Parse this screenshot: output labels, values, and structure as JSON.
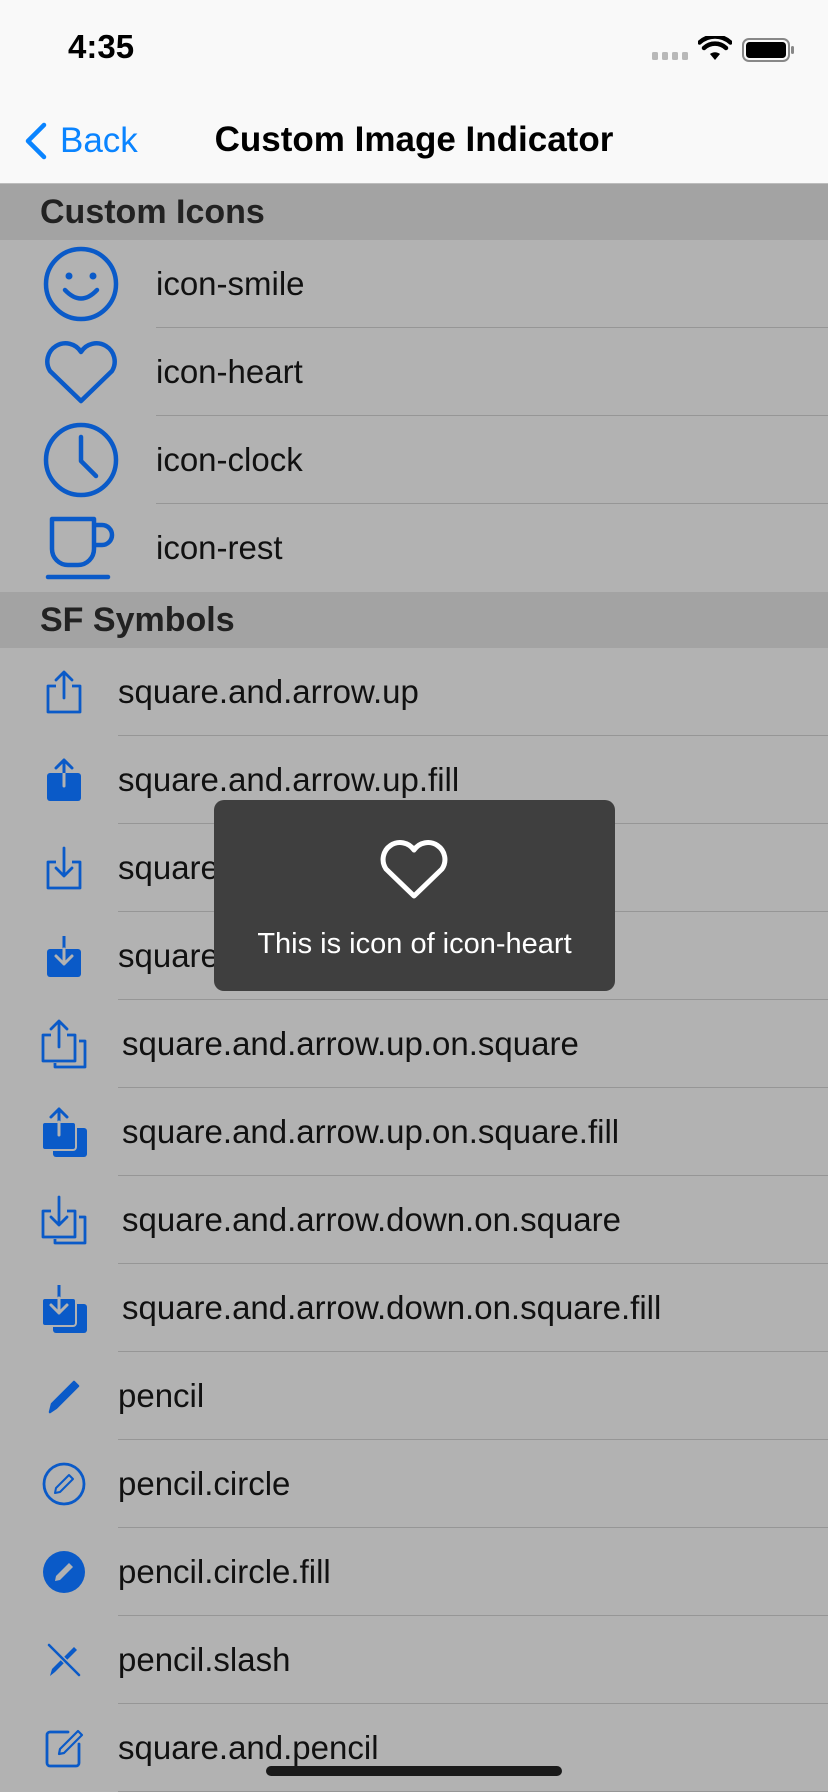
{
  "status_bar": {
    "time": "4:35"
  },
  "nav": {
    "back_label": "Back",
    "title": "Custom Image Indicator"
  },
  "sections": [
    {
      "header": "Custom Icons",
      "items": [
        {
          "icon": "smile-icon",
          "label": "icon-smile"
        },
        {
          "icon": "heart-icon",
          "label": "icon-heart"
        },
        {
          "icon": "clock-icon",
          "label": "icon-clock"
        },
        {
          "icon": "cup-icon",
          "label": "icon-rest"
        }
      ]
    },
    {
      "header": "SF Symbols",
      "items": [
        {
          "icon": "square-and-arrow-up-icon",
          "label": "square.and.arrow.up"
        },
        {
          "icon": "square-and-arrow-up-fill-icon",
          "label": "square.and.arrow.up.fill"
        },
        {
          "icon": "square-and-arrow-down-icon",
          "label": "square.and.arrow.down"
        },
        {
          "icon": "square-and-arrow-down-fill-icon",
          "label": "square.and.arrow.down.fill"
        },
        {
          "icon": "square-and-arrow-up-on-square-icon",
          "label": "square.and.arrow.up.on.square"
        },
        {
          "icon": "square-and-arrow-up-on-square-fill-icon",
          "label": "square.and.arrow.up.on.square.fill"
        },
        {
          "icon": "square-and-arrow-down-on-square-icon",
          "label": "square.and.arrow.down.on.square"
        },
        {
          "icon": "square-and-arrow-down-on-square-fill-icon",
          "label": "square.and.arrow.down.on.square.fill"
        },
        {
          "icon": "pencil-icon",
          "label": "pencil"
        },
        {
          "icon": "pencil-circle-icon",
          "label": "pencil.circle"
        },
        {
          "icon": "pencil-circle-fill-icon",
          "label": "pencil.circle.fill"
        },
        {
          "icon": "pencil-slash-icon",
          "label": "pencil.slash"
        },
        {
          "icon": "square-and-pencil-icon",
          "label": "square.and.pencil"
        }
      ]
    }
  ],
  "hud": {
    "icon": "heart-icon",
    "message": "This is icon of icon-heart"
  },
  "colors": {
    "accent": "#0a84ff",
    "icon_blue": "#0a5ac8",
    "hud_bg": "#3f3f3f"
  }
}
